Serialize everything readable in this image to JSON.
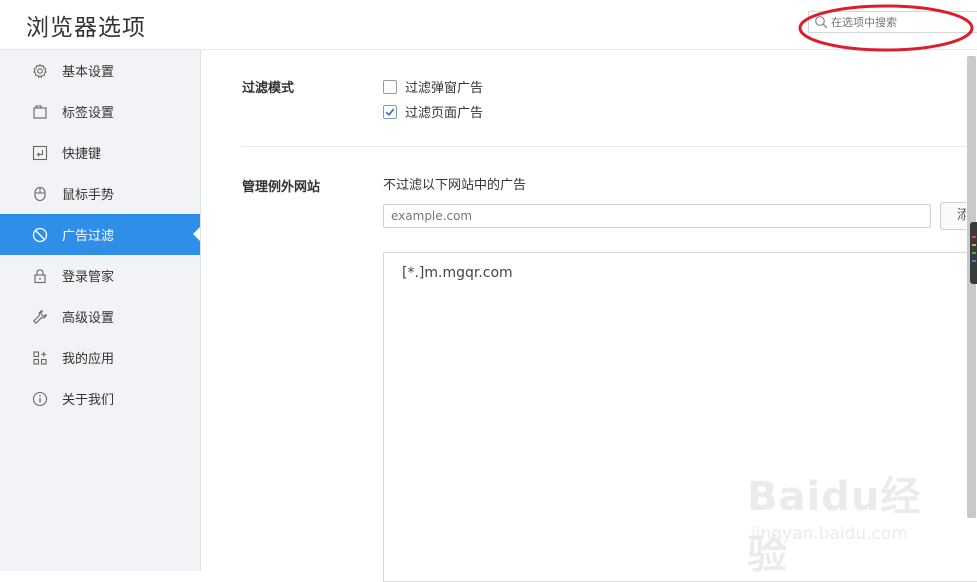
{
  "window": {
    "title": "浏览器选项"
  },
  "search": {
    "placeholder": "在选项中搜索"
  },
  "sidebar": {
    "items": [
      {
        "label": "基本设置",
        "icon": "gear-icon"
      },
      {
        "label": "标签设置",
        "icon": "tabs-icon"
      },
      {
        "label": "快捷键",
        "icon": "keyboard-shortcut-icon"
      },
      {
        "label": "鼠标手势",
        "icon": "mouse-icon"
      },
      {
        "label": "广告过滤",
        "icon": "block-icon",
        "active": true
      },
      {
        "label": "登录管家",
        "icon": "lock-icon"
      },
      {
        "label": "高级设置",
        "icon": "wrench-icon"
      },
      {
        "label": "我的应用",
        "icon": "apps-icon"
      },
      {
        "label": "关于我们",
        "icon": "info-icon"
      }
    ]
  },
  "filter_mode": {
    "label": "过滤模式",
    "options": [
      {
        "label": "过滤弹窗广告",
        "checked": false
      },
      {
        "label": "过滤页面广告",
        "checked": true
      }
    ]
  },
  "exceptions": {
    "label": "管理例外网站",
    "description": "不过滤以下网站中的广告",
    "input_placeholder": "example.com",
    "add_button_label": "添",
    "sites": [
      "[*.]m.mgqr.com"
    ]
  },
  "watermark": {
    "main": "Baidu经验",
    "sub": "jingyan.baidu.com"
  },
  "colors": {
    "accent": "#2f8fe8",
    "sidebar_bg": "#f1f3f6",
    "highlight": "#d9202a"
  }
}
